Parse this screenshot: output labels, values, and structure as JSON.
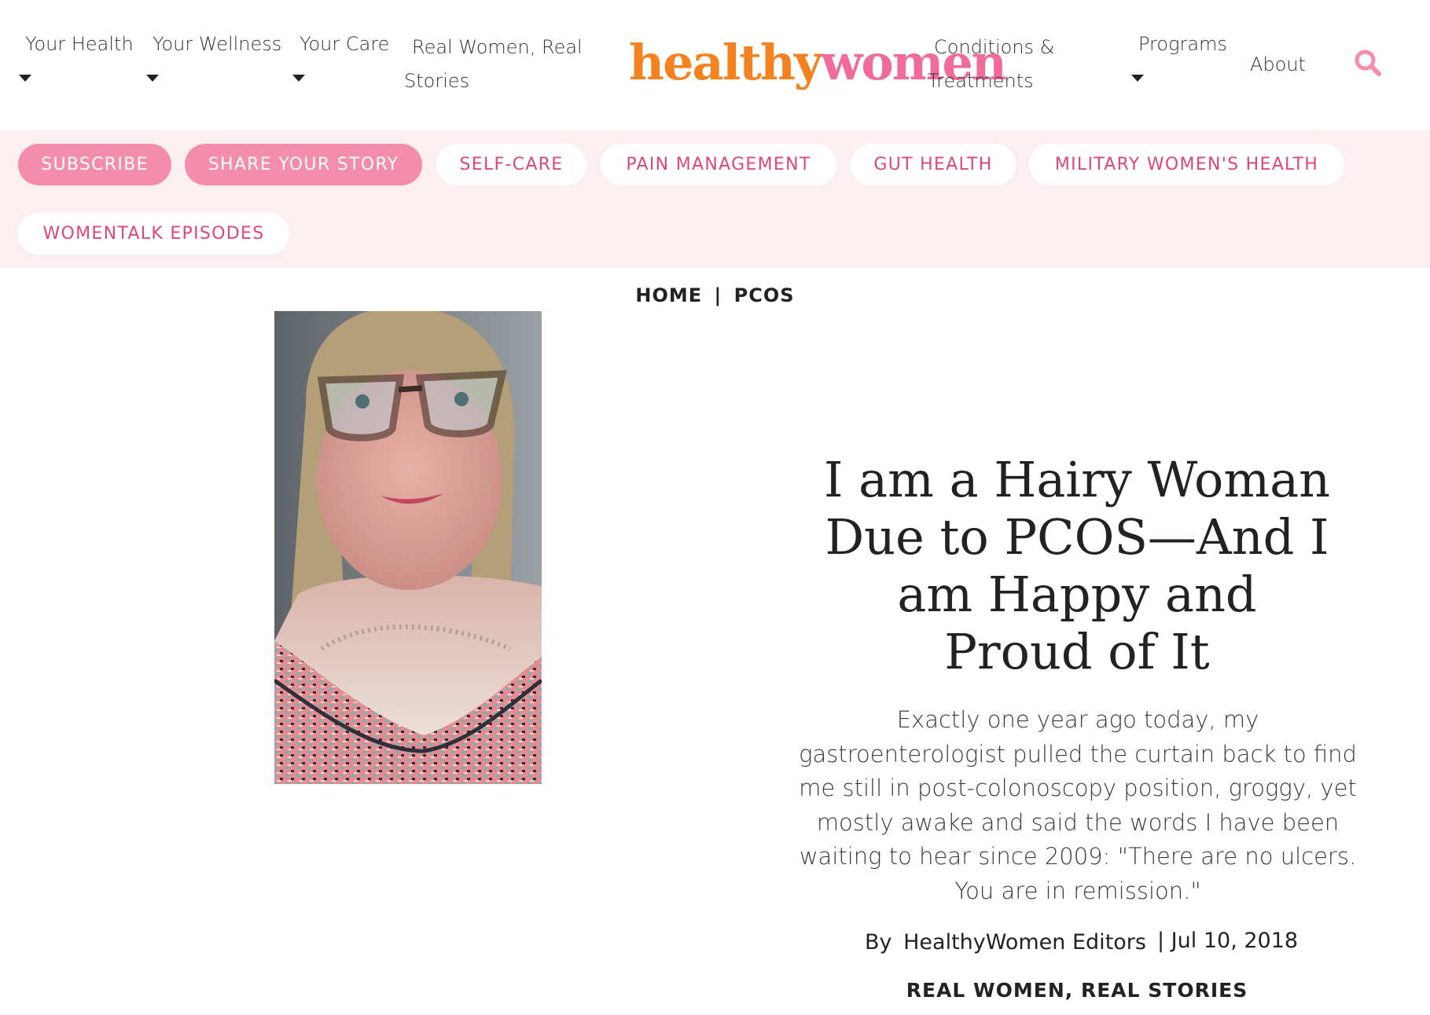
{
  "nav": {
    "your_health": "Your Health",
    "your_wellness": "Your Wellness",
    "your_care": "Your Care",
    "real_women_1": "Real Women, Real",
    "real_women_2": "Stories",
    "conditions_1": "Conditions &",
    "conditions_2": "Treatments",
    "programs": "Programs",
    "about": "About"
  },
  "logo": {
    "part1": "healthy",
    "part2": "women"
  },
  "pills": {
    "subscribe": "SUBSCRIBE",
    "share_story": "SHARE YOUR STORY",
    "self_care": "SELF-CARE",
    "pain_management": "PAIN MANAGEMENT",
    "gut_health": "GUT HEALTH",
    "military": "MILITARY WOMEN'S HEALTH",
    "womentalk": "WOMENTALK EPISODES"
  },
  "breadcrumb": {
    "home": "HOME",
    "sep": "|",
    "section": "PCOS"
  },
  "article": {
    "title": "I am a Hairy Woman Due to PCOS—And I am Happy and Proud of It",
    "dek": "Exactly one year ago today, my gastroenterologist pulled the curtain back to find me still in post-colonoscopy position, groggy, yet mostly awake and said the words I have been waiting to hear since 2009: \"There are no ulcers. You are in remission.\"",
    "by": "By",
    "author": "HealthyWomen Editors",
    "date": "| Jul 10, 2018",
    "category": "REAL WOMEN, REAL STORIES"
  },
  "colors": {
    "logo_orange": "#f58220",
    "logo_pink": "#f06a9b",
    "pill_solid": "#f48cab",
    "pill_text": "#e0457b",
    "pill_bar_bg": "#fbeff1"
  }
}
